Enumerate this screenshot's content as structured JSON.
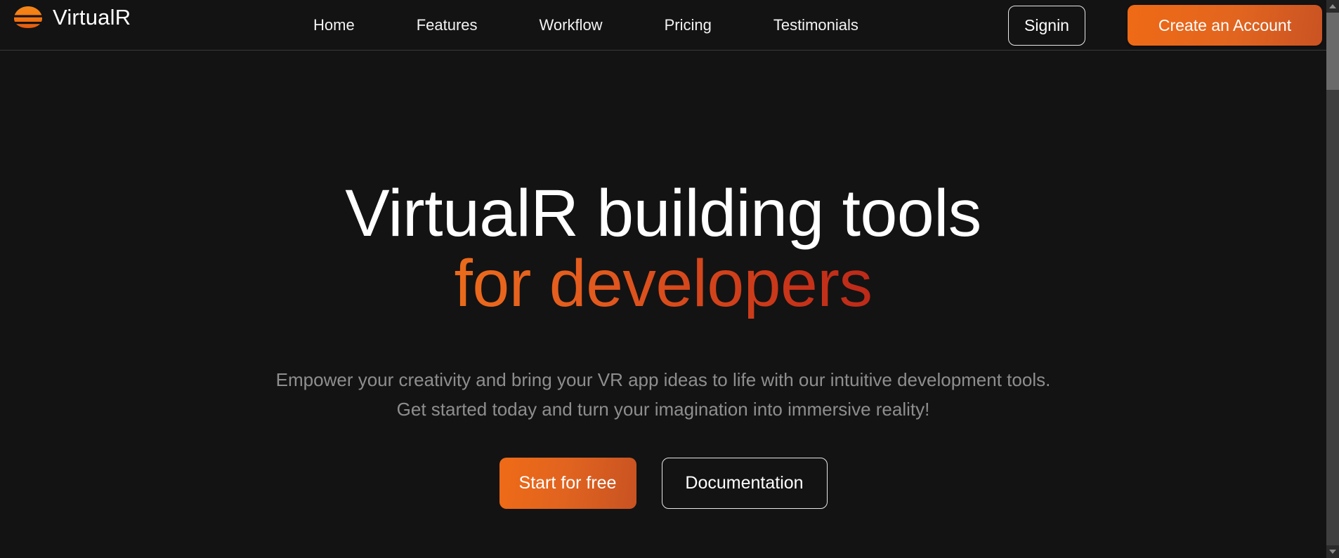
{
  "colors": {
    "page_background": "#111111",
    "surface": "#131313",
    "accent_orange": "#ef6a16",
    "accent_red": "#ad1d18",
    "text_primary": "#ffffff",
    "text_muted": "#8e8e8e",
    "border": "#e8e8e8",
    "header_divider": "#3a3a3a"
  },
  "header": {
    "brand": {
      "logo_icon": "virtualr-striped-hex-logo-icon",
      "name": "VirtualR"
    },
    "nav": [
      {
        "label": "Home"
      },
      {
        "label": "Features"
      },
      {
        "label": "Workflow"
      },
      {
        "label": "Pricing"
      },
      {
        "label": "Testimonials"
      }
    ],
    "signin_label": "Signin",
    "create_account_label": "Create an Account"
  },
  "hero": {
    "title_line1": "VirtualR building tools",
    "title_line2": "for developers",
    "subtitle_line1": "Empower your creativity and bring your VR app ideas to life with our intuitive development tools.",
    "subtitle_line2": "Get started today and turn your imagination into immersive reality!",
    "primary_cta_label": "Start for free",
    "secondary_cta_label": "Documentation"
  },
  "scrollbar": {
    "up_arrow_icon": "chevron-up-icon",
    "down_arrow_icon": "chevron-down-icon"
  }
}
